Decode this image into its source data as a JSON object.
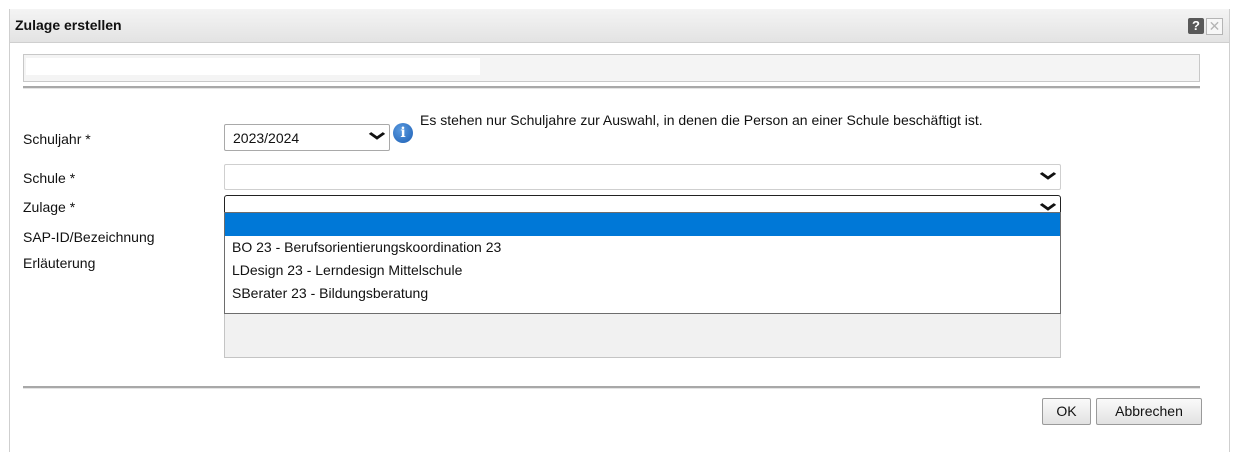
{
  "dialog": {
    "title": "Zulage erstellen",
    "help_label": "?",
    "close_label": "✕"
  },
  "form": {
    "schuljahr": {
      "label": "Schuljahr *",
      "value": "2023/2024",
      "info": "Es stehen nur Schuljahre zur Auswahl, in denen die Person an einer Schule beschäftigt ist."
    },
    "schule": {
      "label": "Schule *",
      "value": ""
    },
    "zulage": {
      "label": "Zulage *",
      "value": "",
      "options": [
        "",
        "BO 23 - Berufsorientierungskoordination 23",
        "LDesign 23 - Lerndesign Mittelschule",
        "SBerater 23 - Bildungsberatung"
      ]
    },
    "sap_label": "SAP-ID/Bezeichnung",
    "erlaeuterung_label": "Erläuterung"
  },
  "buttons": {
    "ok": "OK",
    "cancel": "Abbrechen"
  }
}
